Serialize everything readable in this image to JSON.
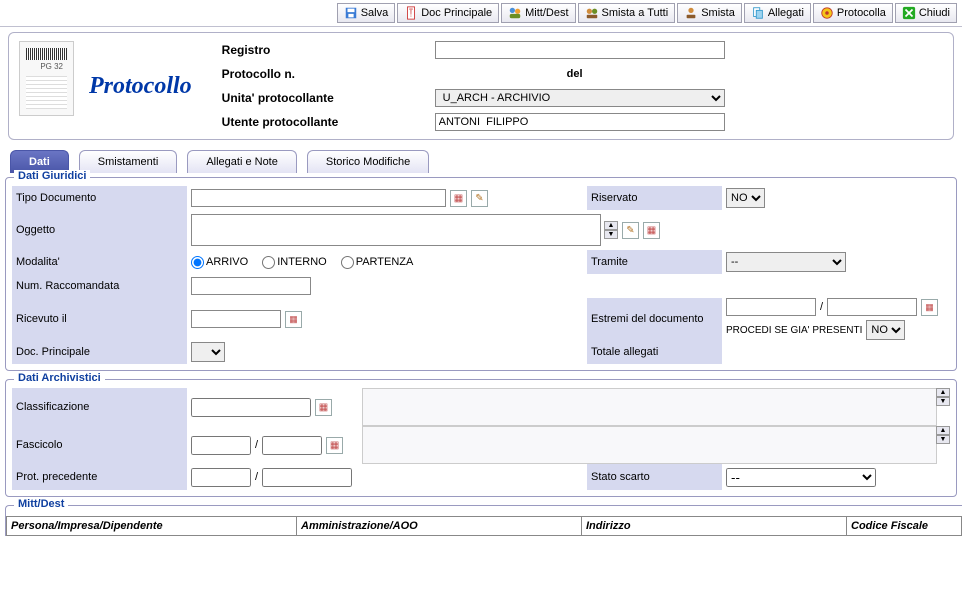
{
  "toolbar": {
    "salva": "Salva",
    "doc_principale": "Doc Principale",
    "mitt_dest": "Mitt/Dest",
    "smista_tutti": "Smista a Tutti",
    "smista": "Smista",
    "allegati": "Allegati",
    "protocolla": "Protocolla",
    "chiudi": "Chiudi"
  },
  "header": {
    "app_title": "Protocollo",
    "thumb_pg": "PG 32",
    "registro_label": "Registro",
    "registro_value": "",
    "protocollo_n_label": "Protocollo n.",
    "protocollo_n_value": "",
    "del_label": "del",
    "del_value": "",
    "unita_label": "Unita' protocollante",
    "unita_value": "U_ARCH - ARCHIVIO",
    "utente_label": "Utente protocollante",
    "utente_value": "ANTONI  FILIPPO"
  },
  "tabs": {
    "dati": "Dati",
    "smistamenti": "Smistamenti",
    "allegati_note": "Allegati e Note",
    "storico": "Storico Modifiche"
  },
  "giuridici": {
    "title": "Dati Giuridici",
    "tipo_doc_label": "Tipo Documento",
    "tipo_doc_value": "",
    "riservato_label": "Riservato",
    "riservato_value": "NO",
    "oggetto_label": "Oggetto",
    "oggetto_value": "",
    "modalita_label": "Modalita'",
    "modalita_options": {
      "arrivo": "ARRIVO",
      "interno": "INTERNO",
      "partenza": "PARTENZA"
    },
    "modalita_selected": "ARRIVO",
    "tramite_label": "Tramite",
    "tramite_value": "--",
    "num_rac_label": "Num. Raccomandata",
    "num_rac_value": "",
    "ricevuto_label": "Ricevuto il",
    "ricevuto_value": "",
    "estremi_label": "Estremi del documento",
    "estremi_a": "",
    "estremi_b": "",
    "procedi_label": "PROCEDI SE GIA' PRESENTI",
    "procedi_value": "NO",
    "doc_principale_label": "Doc. Principale",
    "doc_principale_value": "",
    "totale_allegati_label": "Totale allegati",
    "totale_allegati_value": ""
  },
  "archivistici": {
    "title": "Dati Archivistici",
    "classificazione_label": "Classificazione",
    "classificazione_value": "",
    "class_text": "",
    "fascicolo_label": "Fascicolo",
    "fasc_a": "",
    "fasc_b": "",
    "fasc_text": "",
    "prot_prec_label": "Prot. precedente",
    "prot_prec_a": "",
    "prot_prec_b": "",
    "stato_scarto_label": "Stato scarto",
    "stato_scarto_value": "--"
  },
  "mittdest": {
    "title": "Mitt/Dest",
    "cols": {
      "persona": "Persona/Impresa/Dipendente",
      "amministrazione": "Amministrazione/AOO",
      "indirizzo": "Indirizzo",
      "codice_fiscale": "Codice Fiscale"
    }
  }
}
